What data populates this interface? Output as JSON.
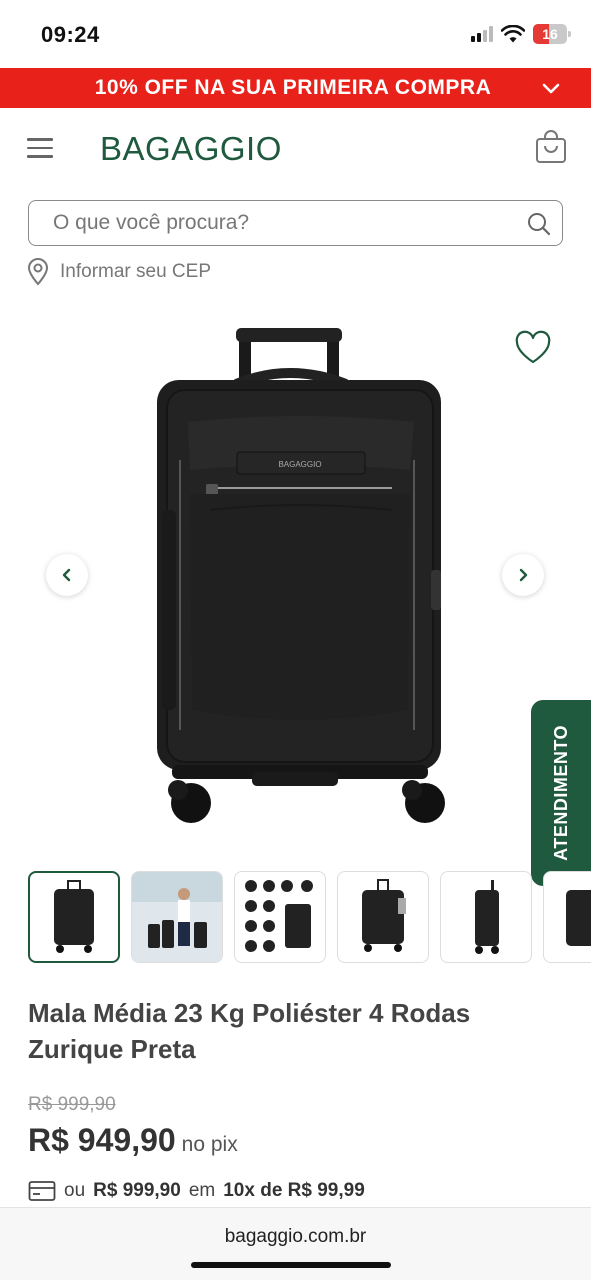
{
  "status_bar": {
    "time": "09:24",
    "battery": "16"
  },
  "promo": {
    "text": "10% OFF NA SUA PRIMEIRA COMPRA"
  },
  "header": {
    "logo": "BAGAGGIO"
  },
  "search": {
    "placeholder": "O que você procura?"
  },
  "cep": {
    "label": "Informar seu CEP"
  },
  "gallery": {
    "brand_tag": "BAGAGGIO"
  },
  "support": {
    "label": "ATENDIMENTO"
  },
  "product": {
    "title": "Mala Média 23 Kg Poliéster 4 Rodas Zurique Preta",
    "old_price": "R$ 999,90",
    "price": "R$ 949,90",
    "price_suffix": "no pix",
    "installment_prefix": "ou",
    "installment_total": "R$ 999,90",
    "installment_mid": "em",
    "installment_plan": "10x de R$ 99,99"
  },
  "browser": {
    "url": "bagaggio.com.br"
  },
  "colors": {
    "brand_green": "#1f5a3f",
    "promo_red": "#e8211b"
  }
}
